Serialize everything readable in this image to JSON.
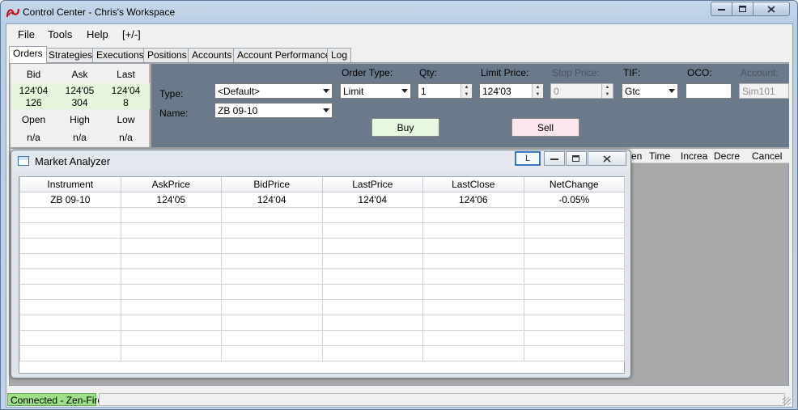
{
  "window": {
    "title": "Control Center - Chris's Workspace"
  },
  "menu": [
    "File",
    "Tools",
    "Help",
    "[+/-]"
  ],
  "tabs": [
    "Orders",
    "Strategies",
    "Executions",
    "Positions",
    "Accounts",
    "Account Performance",
    "Log"
  ],
  "quote": {
    "headers": [
      "Bid",
      "Ask",
      "Last"
    ],
    "prices": [
      "124'04",
      "124'05",
      "124'04"
    ],
    "sizes": [
      "126",
      "304",
      "8"
    ],
    "ohl_headers": [
      "Open",
      "High",
      "Low"
    ],
    "ohl_values": [
      "n/a",
      "n/a",
      "n/a"
    ]
  },
  "order_entry": {
    "type_label": "Type:",
    "type_value": "<Default>",
    "name_label": "Name:",
    "name_value": "ZB 09-10",
    "order_type_label": "Order Type:",
    "order_type_value": "Limit",
    "qty_label": "Qty:",
    "qty_value": "1",
    "limit_price_label": "Limit Price:",
    "limit_price_value": "124'03",
    "stop_price_label": "Stop Price:",
    "stop_price_value": "0",
    "tif_label": "TIF:",
    "tif_value": "Gtc",
    "oco_label": "OCO:",
    "oco_value": "",
    "account_label": "Account:",
    "account_value": "Sim101",
    "buy_label": "Buy",
    "sell_label": "Sell"
  },
  "orders_grid_headers": [
    "en",
    "Time",
    "Increa",
    "Decre",
    "Cancel"
  ],
  "market_analyzer": {
    "title": "Market Analyzer",
    "link_label": "L",
    "columns": [
      "Instrument",
      "AskPrice",
      "BidPrice",
      "LastPrice",
      "LastClose",
      "NetChange"
    ],
    "rows": [
      [
        "ZB 09-10",
        "124'05",
        "124'04",
        "124'04",
        "124'06",
        "-0.05%"
      ]
    ],
    "empty_rows": 10
  },
  "status": {
    "connection": "Connected - Zen-Fire",
    "connection_color": "#9ee08a"
  }
}
